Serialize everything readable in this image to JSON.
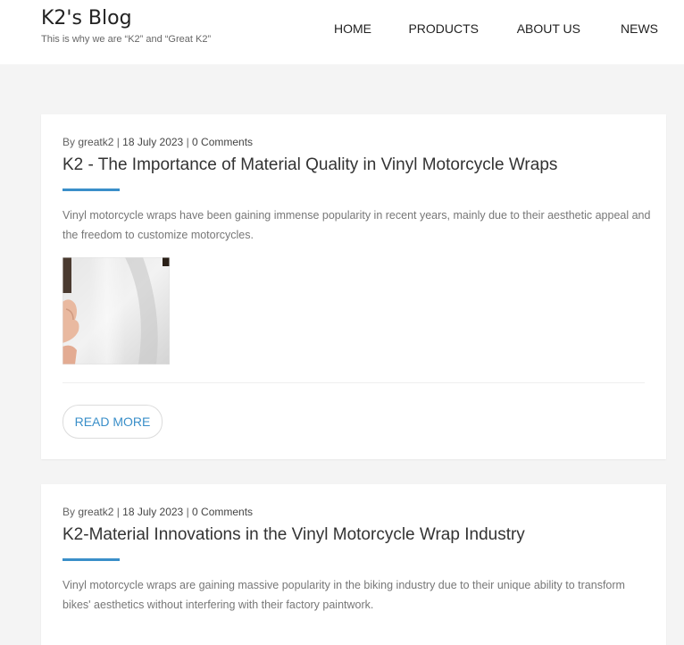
{
  "site": {
    "title": "K2's Blog",
    "tagline": "This is why we are “K2” and “Great K2”"
  },
  "nav": {
    "items": [
      {
        "label": "HOME"
      },
      {
        "label": "PRODUCTS"
      },
      {
        "label": "ABOUT US"
      },
      {
        "label": "NEWS"
      }
    ]
  },
  "posts": [
    {
      "author_prefix": "By ",
      "author": "greatk2",
      "sep1": " | ",
      "date": "18 July 2023",
      "sep2": " | ",
      "comments": "0 Comments",
      "title": "K2 - The Importance of Material Quality in Vinyl Motorcycle Wraps",
      "excerpt": "Vinyl motorcycle wraps have been gaining immense popularity in recent years, mainly due to their aesthetic appeal and the freedom to customize motorcycles.",
      "read_more": "READ MORE"
    },
    {
      "author_prefix": "By ",
      "author": "greatk2",
      "sep1": " | ",
      "date": "18 July 2023",
      "sep2": " | ",
      "comments": "0 Comments",
      "title": "K2-Material Innovations in the Vinyl Motorcycle Wrap Industry",
      "excerpt": "Vinyl motorcycle wraps are gaining massive popularity in the biking industry due to their unique ability to transform bikes' aesthetics without interfering with their factory paintwork."
    }
  ],
  "colors": {
    "accent": "#3a8fc9",
    "background": "#f4f4f4"
  }
}
